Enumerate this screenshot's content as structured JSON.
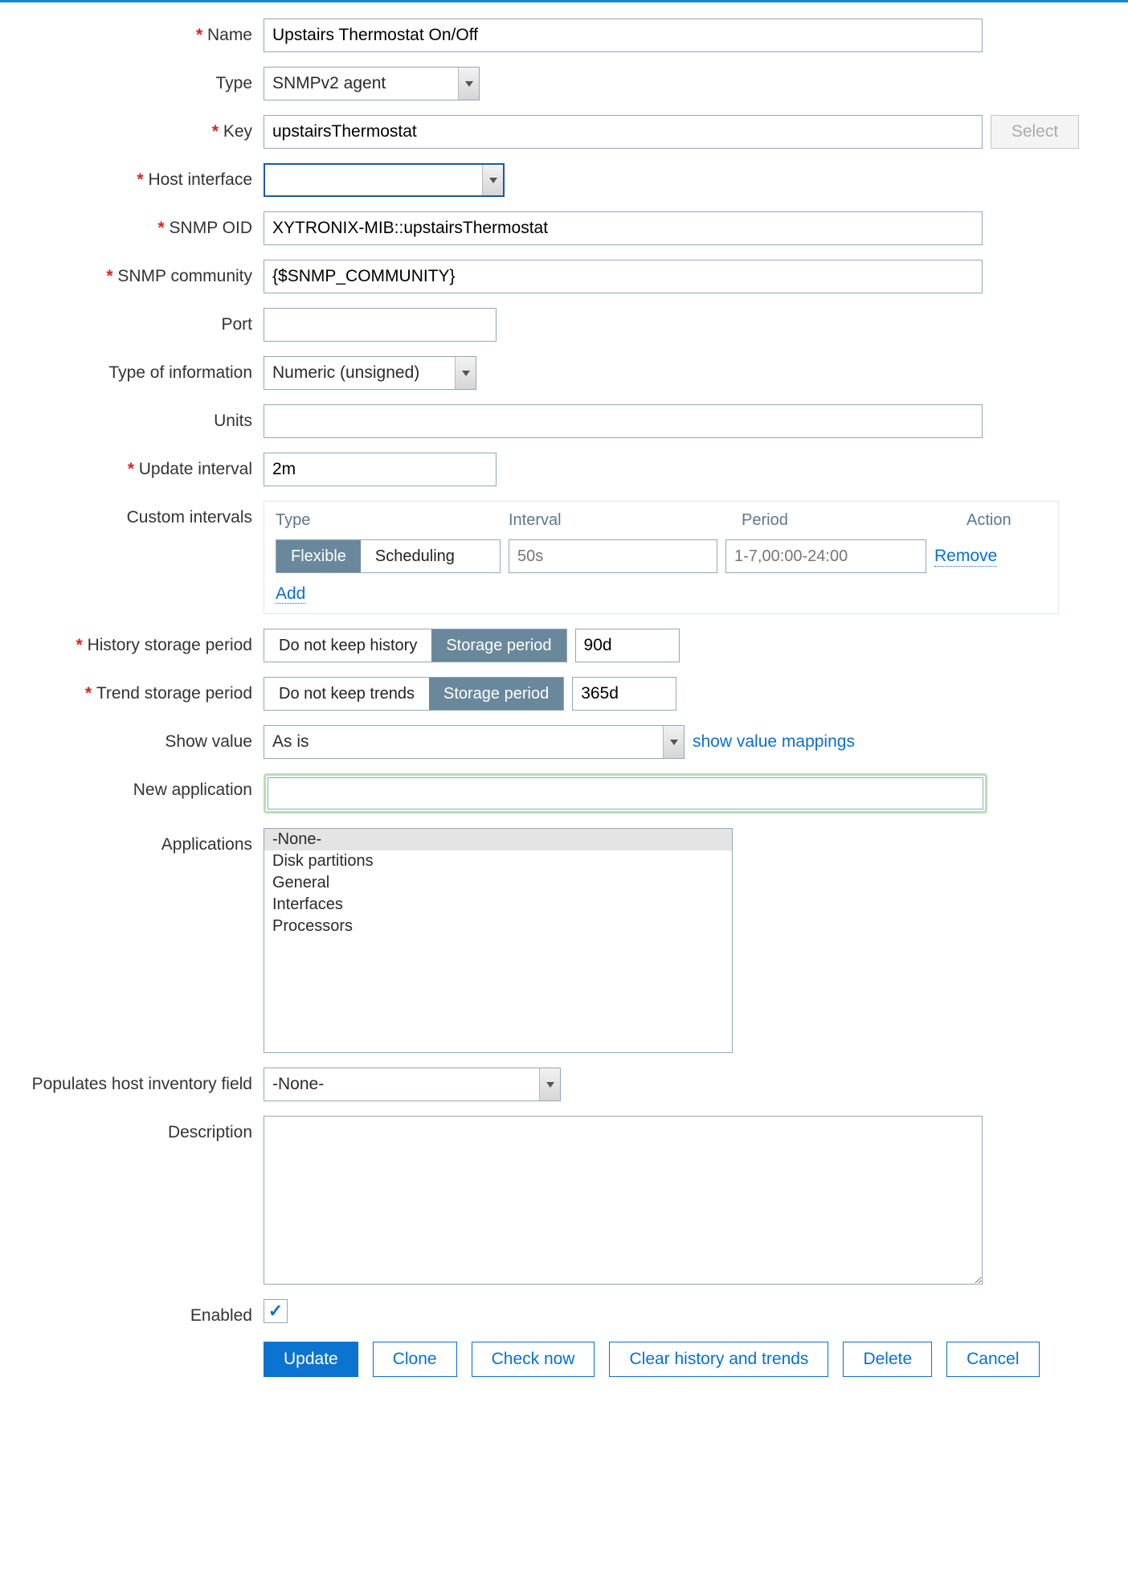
{
  "labels": {
    "name": "Name",
    "type": "Type",
    "key": "Key",
    "host_interface": "Host interface",
    "snmp_oid": "SNMP OID",
    "snmp_community": "SNMP community",
    "port": "Port",
    "type_info": "Type of information",
    "units": "Units",
    "update_interval": "Update interval",
    "custom_intervals": "Custom intervals",
    "history_storage": "History storage period",
    "trend_storage": "Trend storage period",
    "show_value": "Show value",
    "new_application": "New application",
    "applications": "Applications",
    "populates_inventory": "Populates host inventory field",
    "description": "Description",
    "enabled": "Enabled"
  },
  "values": {
    "name": "Upstairs Thermostat On/Off",
    "type": "SNMPv2 agent",
    "key": "upstairsThermostat",
    "host_interface": "      ",
    "snmp_oid": "XYTRONIX-MIB::upstairsThermostat",
    "snmp_community": "{$SNMP_COMMUNITY}",
    "port": "",
    "type_info": "Numeric (unsigned)",
    "units": "",
    "update_interval": "2m",
    "history_value": "90d",
    "trend_value": "365d",
    "show_value": "As is",
    "new_application": "",
    "populates_inventory": "-None-",
    "description": ""
  },
  "custom_intervals": {
    "headers": {
      "type": "Type",
      "interval": "Interval",
      "period": "Period",
      "action": "Action"
    },
    "flexible": "Flexible",
    "scheduling": "Scheduling",
    "interval_placeholder": "50s",
    "period_placeholder": "1-7,00:00-24:00",
    "remove": "Remove",
    "add": "Add"
  },
  "segments": {
    "do_not_keep_history": "Do not keep history",
    "do_not_keep_trends": "Do not keep trends",
    "storage_period": "Storage period"
  },
  "links": {
    "show_value_mappings": "show value mappings"
  },
  "applications_list": [
    "-None-",
    "Disk partitions",
    "General",
    "Interfaces",
    "Processors"
  ],
  "buttons": {
    "select": "Select",
    "update": "Update",
    "clone": "Clone",
    "check_now": "Check now",
    "clear_history": "Clear history and trends",
    "delete": "Delete",
    "cancel": "Cancel"
  }
}
